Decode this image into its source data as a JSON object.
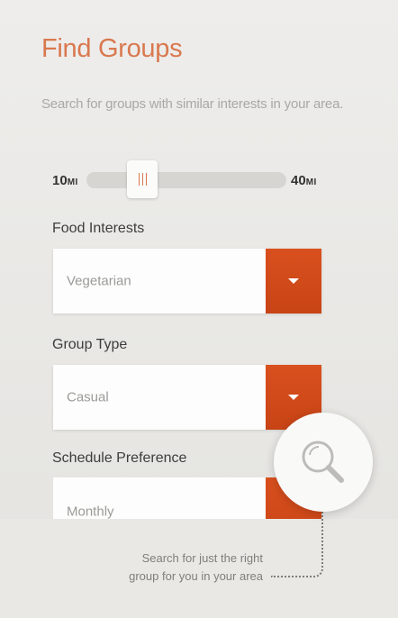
{
  "header": {
    "title": "Find Groups",
    "subtitle": "Search for groups with similar interests in your area."
  },
  "distance": {
    "min_value": "10",
    "min_unit": "MI",
    "max_value": "40",
    "max_unit": "MI",
    "selected_fraction": 0.24
  },
  "fields": {
    "food": {
      "label": "Food Interests",
      "value": "Vegetarian"
    },
    "group_type": {
      "label": "Group Type",
      "value": "Casual"
    },
    "schedule": {
      "label": "Schedule Preference",
      "value": "Monthly"
    }
  },
  "callout": {
    "line1": "Search for just the right",
    "line2": "group for you in your area"
  },
  "icons": {
    "search_icon": "search-icon",
    "dropdown_icon": "chevron-down-icon"
  },
  "colors": {
    "accent": "#d9784f",
    "button": "#d9501e",
    "button_dark": "#c84416"
  }
}
